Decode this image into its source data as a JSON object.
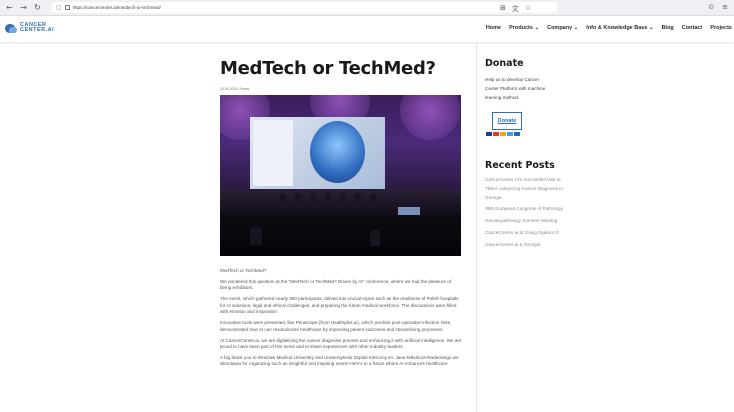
{
  "browser": {
    "back_icon": "back-arrow-icon",
    "forward_icon": "forward-arrow-icon",
    "reload_icon": "reload-icon",
    "url": "https://cancercenter.ai/medtech-or-techmed/",
    "url_glyph": "https://cancercenter.ai/medtech-or-techmed/",
    "back_glyph": "←",
    "forward_glyph": "→",
    "reload_glyph": "↻",
    "shield_glyph": "▢",
    "grid_glyph": "⊞",
    "translate_glyph": "文",
    "star_glyph": "☆",
    "shield2_glyph": "⊙",
    "menu_glyph": "≡"
  },
  "site": {
    "logo_line1": "CANCER",
    "logo_line2": "CENTER.AI",
    "nav": [
      "Home",
      "Products ⌄",
      "Company ⌄",
      "Info & Knowledge Base ⌄",
      "Blog",
      "Contact",
      "Projects"
    ]
  },
  "article": {
    "title": "MedTech or TechMed?",
    "meta": "29.05.2024 | News",
    "paragraphs": [
      "MedTech or TechMed?",
      "We pondered this question at the \"MedTech or TechMed? Driven by AI\" conference, where we had the pleasure of being exhibitors.",
      "The event, which gathered nearly 300 participants, delved into crucial topics such as the readiness of Polish hospitals for AI solutions, legal and ethical challenges, and preparing the future medical workforce. The discussions were filled with emotion and inspiration.",
      "Innovative tools were presented, like Perascope (from Healthplus.ai), which predicts post-operative infection risks, demonstrated how AI can revolutionize healthcare by improving patient outcomes and streamlining processes.",
      "At CancerCenter.ai, we are digitalizing the cancer diagnosis process and enhancing it with artificial intelligence. We are proud to have been part of this event and to share experiences with other industry leaders.",
      "A big thank you to Wroclaw Medical University and Uniwersytecki Szpital Kliniczny im. Jana Mikulicza-Radeckiego we Wrocławiu for organizing such an insightful and inspiring event! Here's to a future where AI enhances healthcare"
    ]
  },
  "sidebar": {
    "donate_title": "Donate",
    "donate_text": "Help us to develop Cancer Center Platform with machine learning method.",
    "donate_button": "Donate",
    "recent_title": "Recent Posts",
    "recent_posts": [
      "CancerCenter.AI's Successful Visit to Tbilisi: Advancing Cancer Diagnosis in Georgia",
      "35th European Congress of Pathology",
      "Hematopathology Summer Meeting",
      "CancerCenter.ai at Going Digital 4.0",
      "CancerCenter.ai & Georgia"
    ],
    "card_colors": [
      "#1a3c8a",
      "#e23a2a",
      "#f2a51a",
      "#4a9be0",
      "#2a62c4"
    ]
  }
}
